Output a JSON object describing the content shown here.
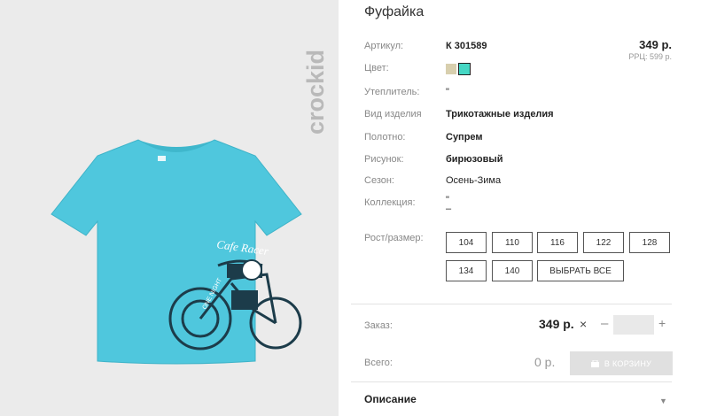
{
  "product": {
    "title": "Фуфайка",
    "price": "349 р.",
    "rrp": "РРЦ: 599 р.",
    "image_alt": "crockid"
  },
  "attributes": {
    "article": {
      "label": "Артикул:",
      "value": "К 301589"
    },
    "color": {
      "label": "Цвет:",
      "swatches": [
        "#d8cfae",
        "#45d7c4"
      ],
      "selected": "#45d7c4"
    },
    "insulation": {
      "label": "Утеплитель:",
      "value": "\""
    },
    "product_type": {
      "label": "Вид изделия",
      "value": "Трикотажные изделия"
    },
    "fabric": {
      "label": "Полотно:",
      "value": "Супрем"
    },
    "pattern": {
      "label": "Рисунок:",
      "value": "бирюзовый"
    },
    "season": {
      "label": "Сезон:",
      "value": "Осень-Зима"
    },
    "collection": {
      "label": "Коллекция:",
      "value_line1": "\"",
      "value_line2": "–"
    }
  },
  "sizes": {
    "label": "Рост/размер:",
    "options": [
      "104",
      "110",
      "116",
      "122",
      "128",
      "134",
      "140"
    ],
    "select_all": "ВЫБРАТЬ ВСЕ"
  },
  "order": {
    "label": "Заказ:",
    "price": "349 р.",
    "remove_icon": "×",
    "minus": "–",
    "plus": "+",
    "quantity": ""
  },
  "total": {
    "label": "Всего:",
    "value": "0 р.",
    "cart_button": "В КОРЗИНУ",
    "cart_icon": "cart-icon"
  },
  "description": {
    "title": "Описание",
    "arrow": "▼"
  }
}
